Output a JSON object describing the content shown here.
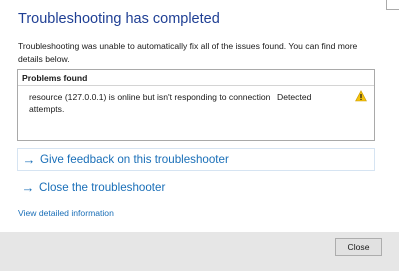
{
  "dialog": {
    "title": "Troubleshooting has completed",
    "description": "Troubleshooting was unable to automatically fix all of the issues found. You can find more details below."
  },
  "problems": {
    "header": "Problems found",
    "items": [
      {
        "description": "resource (127.0.0.1) is online but isn't responding to connection attempts.",
        "status": "Detected",
        "icon": "warning-icon"
      }
    ]
  },
  "actions": {
    "arrow_glyph": "→",
    "feedback_label": "Give feedback on this troubleshooter",
    "close_label": "Close the troubleshooter"
  },
  "details_link": "View detailed information",
  "footer": {
    "close_button": "Close"
  },
  "colors": {
    "title": "#1f3f94",
    "link": "#1a6fb8",
    "warning": "#f4c20d",
    "footer_bg": "#e6e6e6",
    "button_bg": "#e1e1e1"
  }
}
